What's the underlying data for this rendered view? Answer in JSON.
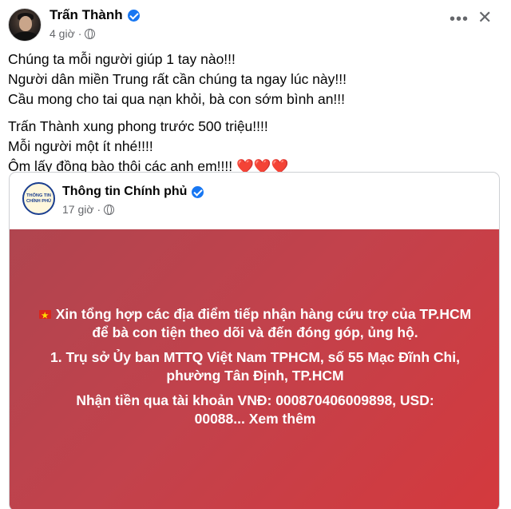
{
  "post": {
    "author": "Trấn Thành",
    "time": "4 giờ",
    "lines": [
      "Chúng ta mỗi người giúp 1 tay nào!!!",
      "Người dân miền Trung rất cần chúng ta ngay lúc này!!!",
      "Cầu mong cho tai qua nạn khỏi, bà con sớm bình an!!!"
    ],
    "lines2": [
      "Trấn Thành xung phong trước 500 triệu!!!!",
      "Mỗi người một ít nhé!!!!",
      "Ôm lấy đồng bào thôi các anh em!!!!"
    ],
    "hearts": "❤️❤️❤️"
  },
  "header_actions": {
    "more": "•••",
    "close": "✕"
  },
  "shared": {
    "page_name": "Thông tin Chính phủ",
    "time": "17 giờ",
    "avatar_text": [
      "THÔNG TIN",
      "CHÍNH PHỦ"
    ],
    "banner": {
      "line1": "Xin tổng hợp các địa điểm tiếp nhận hàng cứu trợ của TP.HCM",
      "line2": "để bà con tiện theo dõi và đến đóng góp, ủng hộ.",
      "line3": "1. Trụ sở Ủy ban MTTQ Việt Nam TPHCM, số 55 Mạc Đĩnh Chi,",
      "line4": "phường Tân Định, TP.HCM",
      "line5": "Nhận tiền qua tài khoản VNĐ: 00087040600989 8, USD:",
      "line5_fixed": "Nhận tiền qua tài khoản VNĐ: 000870406009898, USD:",
      "line6": "00088...",
      "see_more": "Xem thêm"
    }
  },
  "colors": {
    "verified": "#1877f2",
    "banner_start": "#b0454f",
    "banner_end": "#d4393d",
    "meta_text": "#65676b"
  }
}
